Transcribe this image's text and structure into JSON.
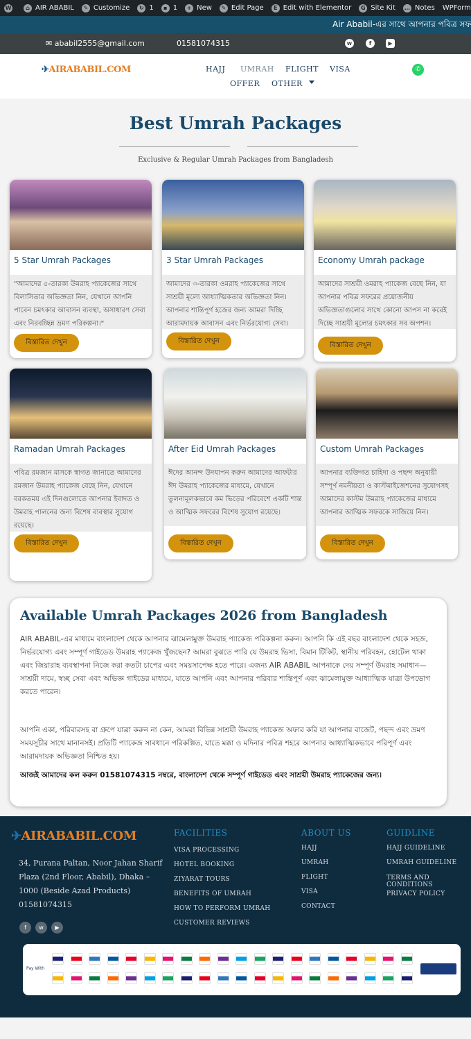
{
  "admin_bar": {
    "site_name": "AIR ABABIL",
    "customize": "Customize",
    "updates_count": "1",
    "comments_count": "1",
    "new_label": "New",
    "edit_page": "Edit Page",
    "edit_elementor": "Edit with Elementor",
    "site_kit": "Site Kit",
    "notes": "Notes",
    "wpforms": "WPForms"
  },
  "ticker": {
    "text": "Air Ababil-এর সাথে আপনার পবিত্র সফর"
  },
  "topbar": {
    "email": "ababil2555@gmail.com",
    "phone": "01581074315"
  },
  "logo": {
    "text": "AIRABABIL.COM"
  },
  "nav": {
    "items": [
      "HAJJ",
      "UMRAH",
      "FLIGHT",
      "VISA",
      "OFFER",
      "OTHER"
    ]
  },
  "section": {
    "title": "Best Umrah Packages",
    "subtitle": "Exclusive & Regular Umrah Packages from Bangladesh"
  },
  "cards": [
    {
      "title": "5 Star Umrah Packages",
      "desc": "\"আমাদের ৫-তারকা উমরাহ প্যাকেজের সাথে বিলাসিতার অভিজ্ঞতা নিন, যেখানে আপনি পাবেন চমৎকার আবাসন ব্যবস্থা, অসাধারণ সেবা এবং নিরবচ্ছিন্ন ভ্রমণ পরিকল্পনা।\"",
      "button": "বিস্তারিত দেখুন"
    },
    {
      "title": "3 Star Umrah Packages",
      "desc": "আমাদের ৩-তারকা ওমরাহ প্যাকেজের সাথে সাশ্রয়ী মূল্যে আধ্যাত্মিকতার অভিজ্ঞতা নিন। আপনার শান্তিপূর্ণ হজের জন্য আমরা দিচ্ছি আরামদায়ক আবাসন এবং নির্ভরযোগ্য সেবা।",
      "button": "বিস্তারিত দেখুন"
    },
    {
      "title": "Economy Umrah package",
      "desc": "আমাদের সাশ্রয়ী ওমরাহ প্যাকেজ বেছে নিন, যা আপনার পবিত্র সফরের প্রয়োজনীয় অভিজ্ঞতাগুলোর সাথে কোনো আপস না করেই দিচ্ছে সাশ্রয়ী মূল্যের চমৎকার সব অপশন।",
      "button": "বিস্তারিত দেখুন"
    },
    {
      "title": "Ramadan Umrah Packages",
      "desc": "পবিত্র রমজান মাসকে স্বাগত জানাতে আমাদের রমজান উমরাহ প্যাকেজ বেছে নিন, যেখানে বরকতময় এই দিনগুলোতে আপনার ইবাদত ও উমরাহ পালনের জন্য বিশেষ ব্যবস্থার সুযোগ রয়েছে।",
      "button": "বিস্তারিত দেখুন"
    },
    {
      "title": "After Eid Umrah Packages",
      "desc": "ঈদের আনন্দ উদযাপন করুন আমাদের আফটার ঈদ উমরাহ প্যাকেজের মাধ্যমে, যেখানে তুলনামূলকভাবে কম ভিড়ের পরিবেশে একটি শান্ত ও আত্মিক সফরের বিশেষ সুযোগ রয়েছে।",
      "button": "বিস্তারিত দেখুন"
    },
    {
      "title": "Custom Umrah Packages",
      "desc": "আপনার ব্যক্তিগত চাহিদা ও পছন্দ অনুযায়ী সম্পূর্ণ নমনীয়তা ও কাস্টমাইজেশনের সুযোগসহ আমাদের কাস্টম উমরাহ প্যাকেজের মাধ্যমে আপনার আত্মিক সফরকে সাজিয়ে নিন।",
      "button": "বিস্তারিত দেখুন"
    }
  ],
  "about": {
    "title": "Available Umrah Packages 2026 from Bangladesh",
    "p1": "AIR ABABIL-এর মাধ্যমে বাংলাদেশ থেকে আপনার ঝামেলামুক্ত উমরাহ প্যাকেজ পরিকল্পনা করুন। আপনি কি এই বছর বাংলাদেশ থেকে সহজ, নির্ভরযোগ্য এবং সম্পূর্ণ গাইডেড উমরাহ প্যাকেজ খুঁজছেন? আমরা বুঝতে পারি যে উমরাহ ভিসা, বিমান টিকিট, স্থানীয় পরিবহন, হোটেল থাকা এবং জিয়ারাহ ব্যবস্থাপনা নিজে করা কতটা চাপের এবং সময়সাপেক্ষ হতে পারে। এজন্য AIR ABABIL আপনাকে দেয় সম্পূর্ণ উমরাহ সমাধান—সাশ্রয়ী দামে, স্বচ্ছ সেবা এবং অভিজ্ঞ গাইডের মাধ্যমে, যাতে আপনি এবং আপনার পরিবার শান্তিপূর্ণ এবং ঝামেলামুক্ত আধ্যাত্মিক যাত্রা উপভোগ করতে পারেন।",
    "p2": "আপনি একা, পরিবারসহ বা গ্রুপে যাত্রা করুন না কেন, আমরা বিভিন্ন সাশ্রয়ী উমরাহ প্যাকেজ অফার করি যা আপনার বাজেট, পছন্দ এবং ভ্রমণ সময়সূচীর সাথে মানানসই। প্রতিটি প্যাকেজ সাবধানে পরিকল্পিত, যাতে মক্কা ও মদিনার পবিত্র শহরে আপনার আধ্যাত্মিকভাবে পরিপূর্ণ এবং আরামদায়ক অভিজ্ঞতা নিশ্চিত হয়।",
    "p3": "আজই আমাদের কল করুন 01581074315 নম্বরে, বাংলাদেশ থেকে সম্পূর্ণ গাইডেড এবং সাশ্রয়ী উমরাহ প্যাকেজের জন্য।"
  },
  "footer": {
    "logo": "AIRABABIL.COM",
    "address": "34, Purana Paltan, Noor Jahan Sharif Plaza (2nd Floor, Ababil), Dhaka – 1000 (Beside Azad Products)",
    "phone": "01581074315",
    "facilities_title": "FACILITIES",
    "facilities": [
      "VISA PROCESSING",
      "HOTEL BOOKING",
      "ZIYARAT TOURS",
      "BENEFITS OF UMRAH",
      "HOW TO PERFORM UMRAH",
      "CUSTOMER REVIEWS"
    ],
    "about_title": "ABOUT US",
    "about_links": [
      "HAJJ",
      "UMRAH",
      "FLIGHT",
      "VISA",
      "CONTACT"
    ],
    "guide_title": "GUIDLINE",
    "guide_links": [
      "HAJJ GUIDELINE",
      "UMRAH GUIDELINE",
      "TERMS AND CONDITIONS",
      "PRIVACY POLICY"
    ]
  },
  "payment": {
    "label": "Pay With"
  },
  "colors": {
    "accent": "#d4930d",
    "brand": "#1a4a6b",
    "footer": "#0f2c3f"
  }
}
